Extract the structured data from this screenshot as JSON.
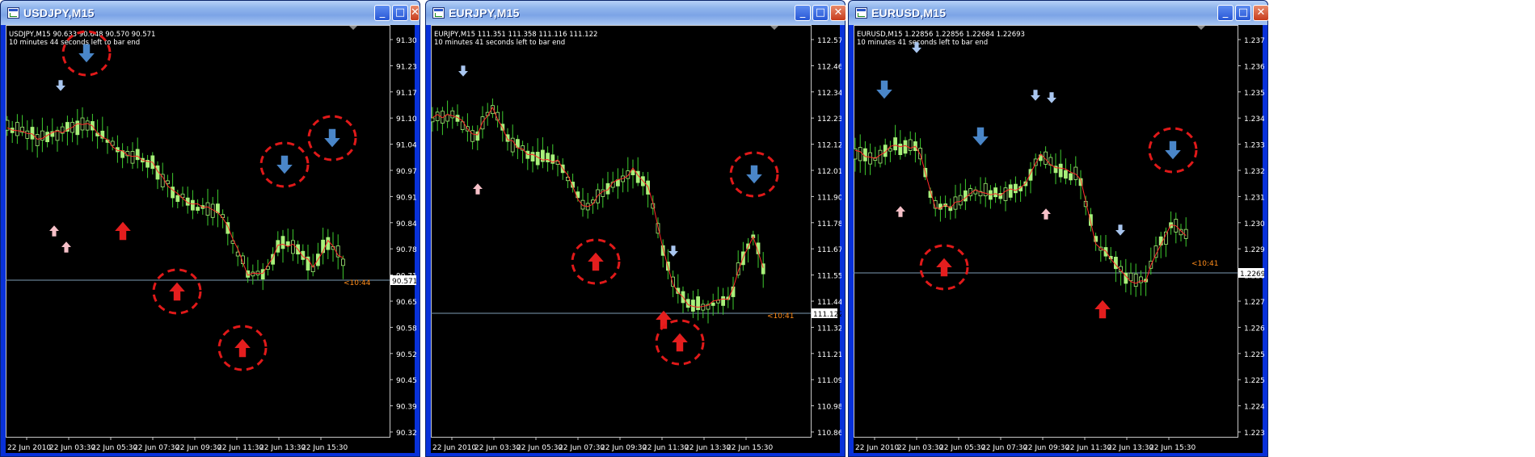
{
  "windows": [
    {
      "title": "USDJPY,M15",
      "info_line1": "USDJPY,M15  90.633 90.648 90.570 90.571",
      "info_line2": "10 minutes 44 seconds left to bar end",
      "price_levels": [
        "91.300",
        "91.235",
        "91.170",
        "91.105",
        "91.040",
        "90.975",
        "90.910",
        "90.845",
        "90.780",
        "90.715",
        "90.650",
        "90.585",
        "90.520",
        "90.455",
        "90.390",
        "90.325"
      ],
      "current_price_tag": "90.571",
      "countdown_label": "<10:44",
      "time_labels": [
        "22 Jun 2010",
        "22 Jun 03:30",
        "22 Jun 05:30",
        "22 Jun 07:30",
        "22 Jun 09:30",
        "22 Jun 11:30",
        "22 Jun 13:30",
        "22 Jun 15:30"
      ]
    },
    {
      "title": "EURJPY,M15",
      "info_line1": "EURJPY,M15  111.351 111.358 111.116 111.122",
      "info_line2": "10 minutes 41 seconds left to bar end",
      "price_levels": [
        "112.575",
        "112.460",
        "112.345",
        "112.235",
        "112.120",
        "112.010",
        "111.900",
        "111.785",
        "111.670",
        "111.555",
        "111.440",
        "111.325",
        "111.215",
        "111.095",
        "110.980",
        "110.865"
      ],
      "current_price_tag": "111.122",
      "countdown_label": "<10:41",
      "time_labels": [
        "22 Jun 2010",
        "22 Jun 03:30",
        "22 Jun 05:30",
        "22 Jun 07:30",
        "22 Jun 09:30",
        "22 Jun 11:30",
        "22 Jun 13:30",
        "22 Jun 15:30"
      ]
    },
    {
      "title": "EURUSD,M15",
      "info_line1": "EURUSD,M15  1.22856 1.22856 1.22684 1.22693",
      "info_line2": "10 minutes 41 seconds left to bar end",
      "price_levels": [
        "1.23705",
        "1.23610",
        "1.23520",
        "1.23425",
        "1.23330",
        "1.23240",
        "1.23145",
        "1.23055",
        "1.22960",
        "1.22870",
        "1.22775",
        "1.22693",
        "1.22590",
        "1.22500",
        "1.22405",
        "1.22315"
      ],
      "current_price_tag": "1.22693",
      "countdown_label": "<10:41",
      "time_labels": [
        "22 Jun 2010",
        "22 Jun 03:30",
        "22 Jun 05:30",
        "22 Jun 07:30",
        "22 Jun 09:30",
        "22 Jun 11:30",
        "22 Jun 13:30",
        "22 Jun 15:30"
      ]
    }
  ],
  "buttons": {
    "minimize": "_",
    "maximize": "□",
    "close": "✕"
  },
  "colors": {
    "background": "#000000",
    "bull_candle": "#a8f07a",
    "wick": "#3ecb2e",
    "moving_average": "#ff2a2a",
    "axis_text": "#ffffff",
    "price_line": "#7e9cb3",
    "countdown": "#ff8c1a",
    "sell_arrow": "#4a86c8",
    "sell_arrow_small": "#a9c6ef",
    "buy_arrow": "#e41e1e",
    "buy_arrow_small": "#f6c0c8",
    "highlight_circle": "#e01919"
  },
  "icons": {
    "title_icon": "chart-window-icon",
    "sell_signal": "down-arrow-icon",
    "buy_signal": "up-arrow-icon"
  }
}
